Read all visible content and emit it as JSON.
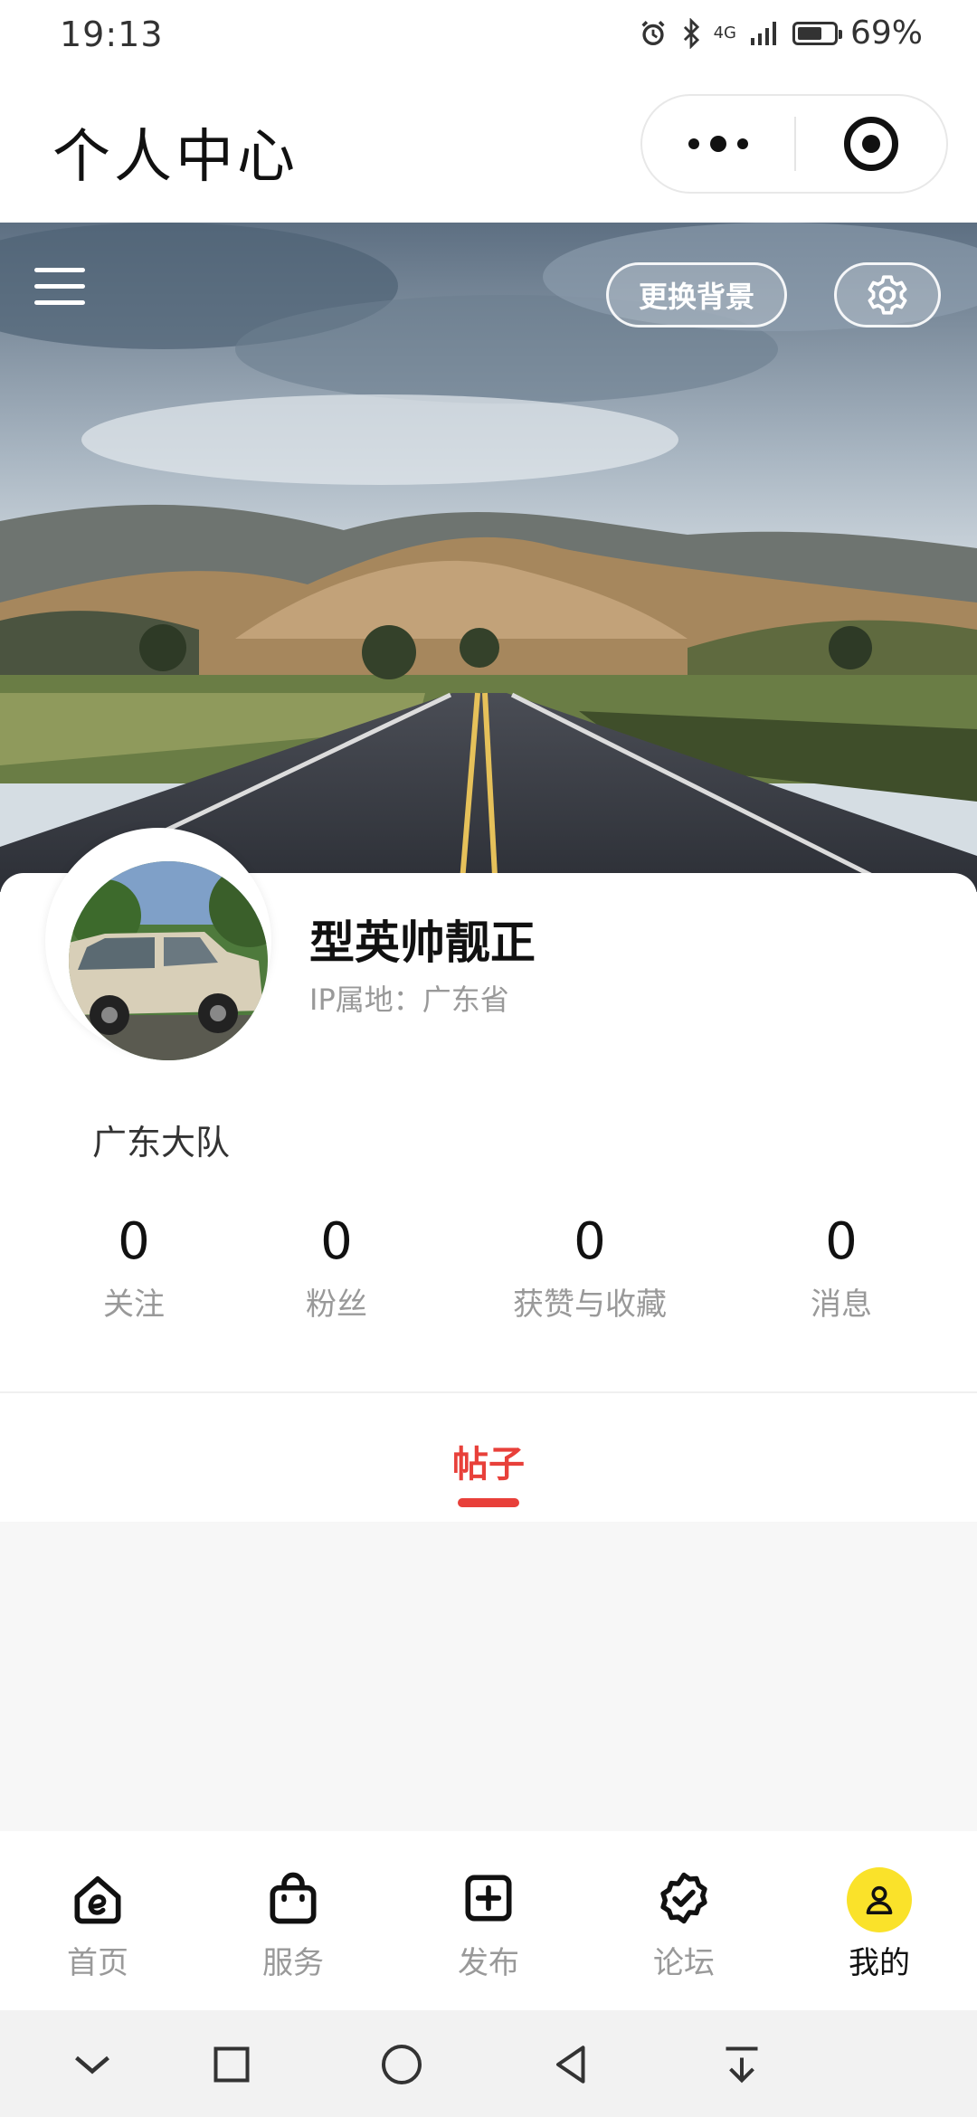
{
  "status_bar": {
    "time": "19:13",
    "network": "4G",
    "battery_percent": "69%",
    "battery_level": 0.69
  },
  "header": {
    "title": "个人中心"
  },
  "banner": {
    "change_bg_label": "更换背景"
  },
  "profile": {
    "username": "型英帅靓正",
    "ip_location": "IP属地：广东省",
    "bio": "广东大队"
  },
  "stats": [
    {
      "value": "0",
      "label": "关注"
    },
    {
      "value": "0",
      "label": "粉丝"
    },
    {
      "value": "0",
      "label": "获赞与收藏"
    },
    {
      "value": "0",
      "label": "消息"
    }
  ],
  "tabs": [
    {
      "label": "帖子",
      "active": true
    }
  ],
  "bottom_nav": [
    {
      "label": "首页",
      "icon": "home-e-icon"
    },
    {
      "label": "服务",
      "icon": "bag-icon"
    },
    {
      "label": "发布",
      "icon": "plus-square-icon"
    },
    {
      "label": "论坛",
      "icon": "badge-check-icon"
    },
    {
      "label": "我的",
      "icon": "user-icon",
      "active": true
    }
  ],
  "colors": {
    "accent": "#e8403a",
    "me_badge": "#fae22a",
    "muted": "#999999"
  }
}
